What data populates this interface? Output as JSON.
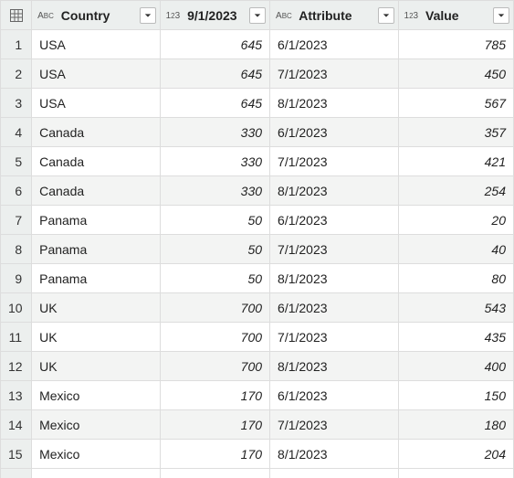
{
  "columns": [
    {
      "type_label": "ABC",
      "label": "Country",
      "kind": "text"
    },
    {
      "type_label": "123",
      "label": "9/1/2023",
      "kind": "number"
    },
    {
      "type_label": "ABC",
      "label": "Attribute",
      "kind": "text"
    },
    {
      "type_label": "123",
      "label": "Value",
      "kind": "number"
    }
  ],
  "rows": [
    {
      "n": "1",
      "country": "USA",
      "sep1": "645",
      "attribute": "6/1/2023",
      "value": "785"
    },
    {
      "n": "2",
      "country": "USA",
      "sep1": "645",
      "attribute": "7/1/2023",
      "value": "450"
    },
    {
      "n": "3",
      "country": "USA",
      "sep1": "645",
      "attribute": "8/1/2023",
      "value": "567"
    },
    {
      "n": "4",
      "country": "Canada",
      "sep1": "330",
      "attribute": "6/1/2023",
      "value": "357"
    },
    {
      "n": "5",
      "country": "Canada",
      "sep1": "330",
      "attribute": "7/1/2023",
      "value": "421"
    },
    {
      "n": "6",
      "country": "Canada",
      "sep1": "330",
      "attribute": "8/1/2023",
      "value": "254"
    },
    {
      "n": "7",
      "country": "Panama",
      "sep1": "50",
      "attribute": "6/1/2023",
      "value": "20"
    },
    {
      "n": "8",
      "country": "Panama",
      "sep1": "50",
      "attribute": "7/1/2023",
      "value": "40"
    },
    {
      "n": "9",
      "country": "Panama",
      "sep1": "50",
      "attribute": "8/1/2023",
      "value": "80"
    },
    {
      "n": "10",
      "country": "UK",
      "sep1": "700",
      "attribute": "6/1/2023",
      "value": "543"
    },
    {
      "n": "11",
      "country": "UK",
      "sep1": "700",
      "attribute": "7/1/2023",
      "value": "435"
    },
    {
      "n": "12",
      "country": "UK",
      "sep1": "700",
      "attribute": "8/1/2023",
      "value": "400"
    },
    {
      "n": "13",
      "country": "Mexico",
      "sep1": "170",
      "attribute": "6/1/2023",
      "value": "150"
    },
    {
      "n": "14",
      "country": "Mexico",
      "sep1": "170",
      "attribute": "7/1/2023",
      "value": "180"
    },
    {
      "n": "15",
      "country": "Mexico",
      "sep1": "170",
      "attribute": "8/1/2023",
      "value": "204"
    }
  ]
}
